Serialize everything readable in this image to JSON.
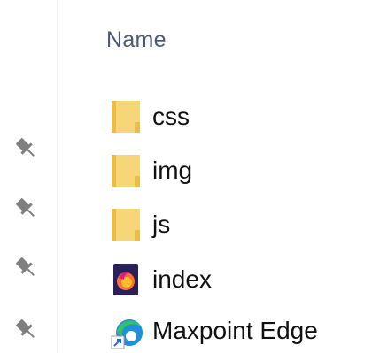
{
  "header": {
    "column_name": "Name"
  },
  "pins": [
    {
      "icon": "pin-icon"
    },
    {
      "icon": "pin-icon"
    },
    {
      "icon": "pin-icon"
    },
    {
      "icon": "pin-icon"
    }
  ],
  "files": [
    {
      "name": "css",
      "icon": "folder-icon"
    },
    {
      "name": "img",
      "icon": "folder-icon"
    },
    {
      "name": "js",
      "icon": "folder-icon"
    },
    {
      "name": "index",
      "icon": "firefox-html-file-icon"
    },
    {
      "name": "Maxpoint Edge",
      "icon": "edge-shortcut-icon"
    }
  ],
  "colors": {
    "folder": "#f6d679",
    "folder_shade": "#e8bd4a",
    "header_text": "#4a5a72",
    "pin": "#7f7f7f"
  }
}
